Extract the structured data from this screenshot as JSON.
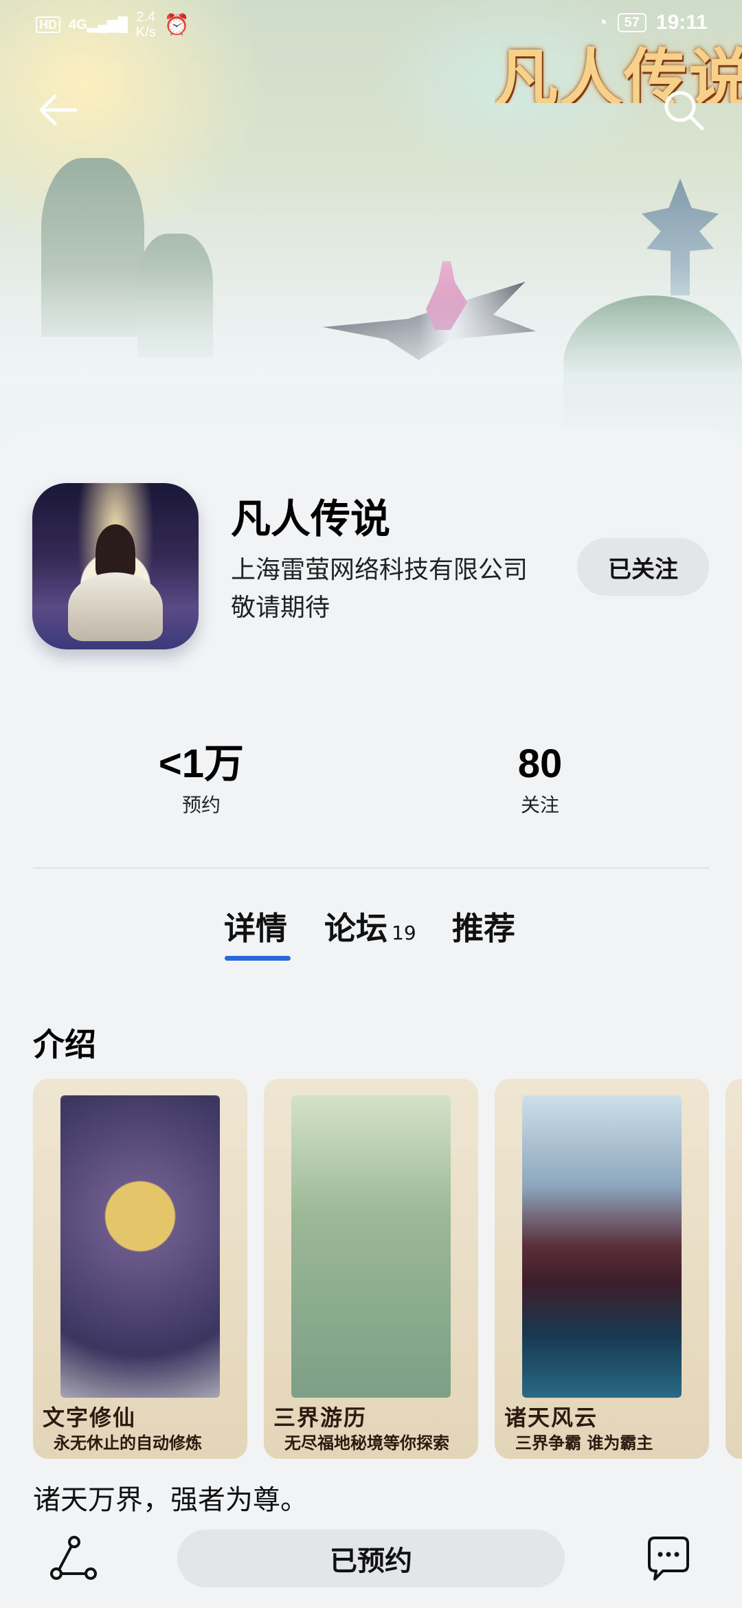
{
  "status_bar": {
    "hd": "HD",
    "signal": "4G",
    "net_speed": "2.4\nK/s",
    "battery": "57",
    "time": "19:11"
  },
  "hero": {
    "title_art": "凡人传说"
  },
  "app": {
    "name": "凡人传说",
    "developer": "上海雷萤网络科技有限公司",
    "status": "敬请期待",
    "follow_label": "已关注"
  },
  "stats": [
    {
      "value": "<1万",
      "label": "预约"
    },
    {
      "value": "80",
      "label": "关注"
    }
  ],
  "tabs": [
    {
      "label": "详情",
      "badge": "",
      "active": true
    },
    {
      "label": "论坛",
      "badge": "19",
      "active": false
    },
    {
      "label": "推荐",
      "badge": "",
      "active": false
    }
  ],
  "intro": {
    "title": "介绍",
    "screenshots": [
      {
        "caption1": "文字修仙",
        "caption2": "永无休止的自动修炼"
      },
      {
        "caption1": "三界游历",
        "caption2": "无尽福地秘境等你探索"
      },
      {
        "caption1": "诸天风云",
        "caption2": "三界争霸 谁为霸主"
      }
    ],
    "text": "诸天万界，强者为尊。"
  },
  "bottom": {
    "reserve_label": "已预约"
  },
  "colors": {
    "accent": "#2968d8",
    "background": "#f1f3f5",
    "button_bg": "#e3e5e8"
  }
}
